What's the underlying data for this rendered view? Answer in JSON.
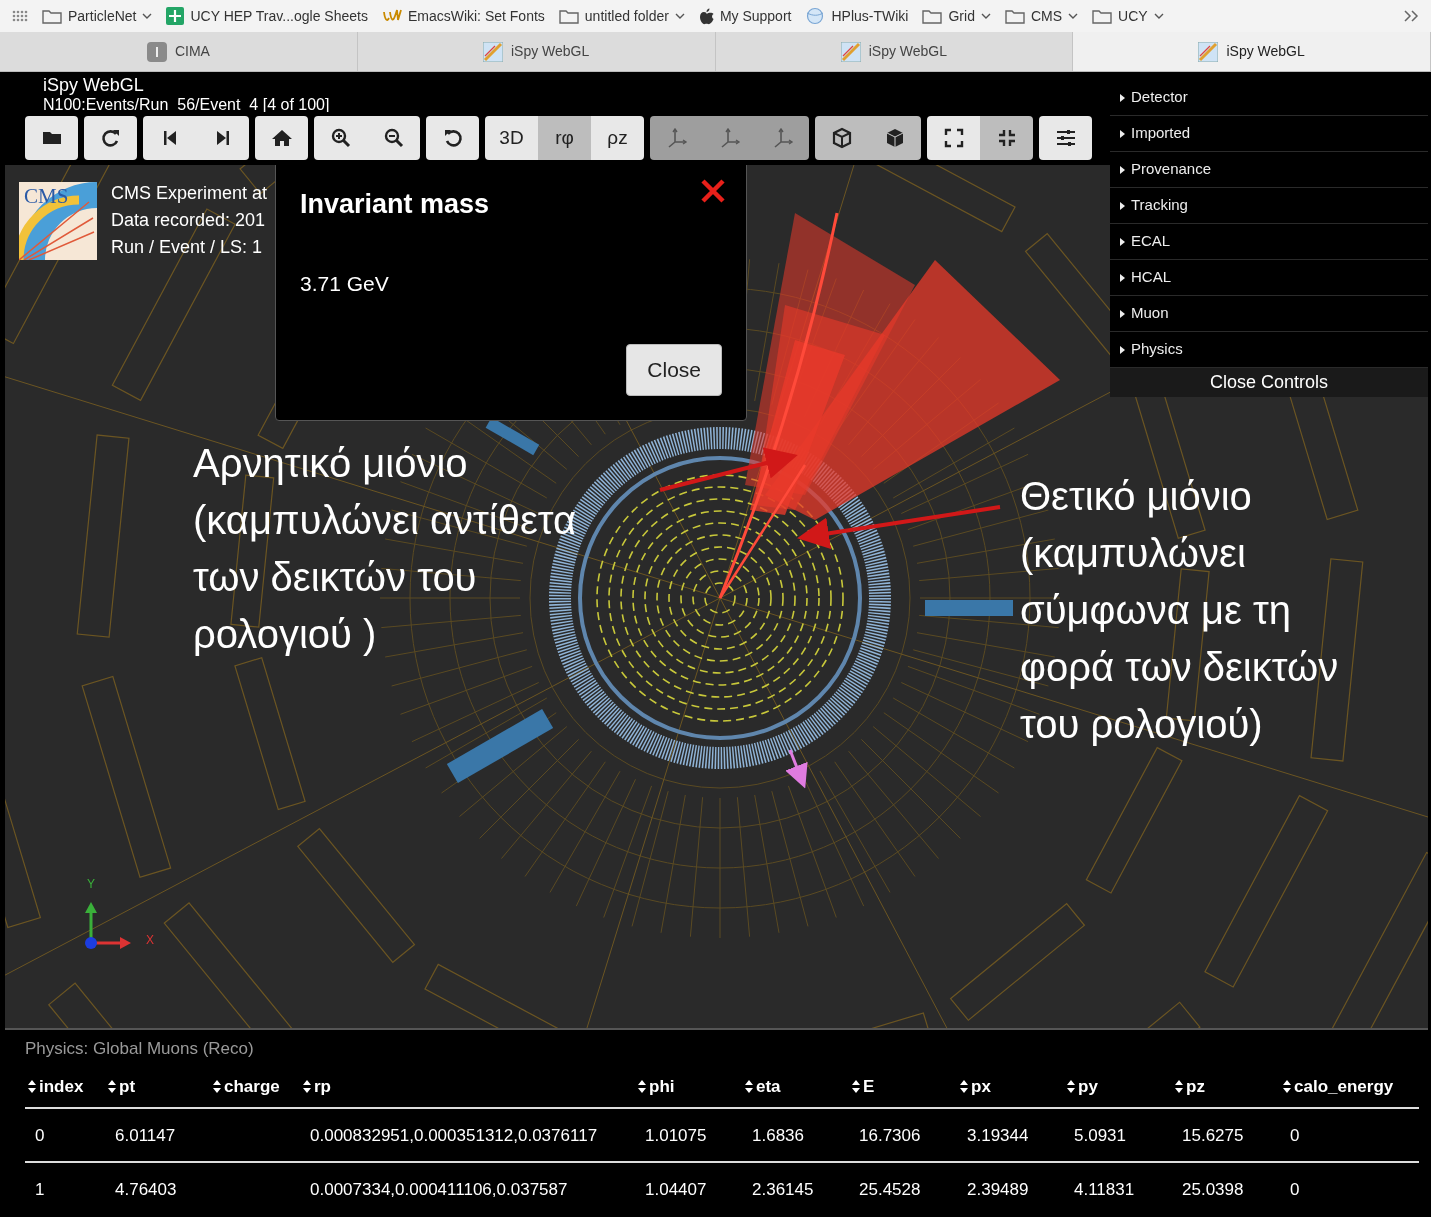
{
  "browser": {
    "bookmarks": [
      {
        "label": "ParticleNet",
        "kind": "folder",
        "has_menu": true
      },
      {
        "label": "UCY HEP Trav...ogle Sheets",
        "kind": "sheet",
        "has_menu": false
      },
      {
        "label": "EmacsWiki: Set Fonts",
        "kind": "wiki",
        "has_menu": false
      },
      {
        "label": "untitled folder",
        "kind": "folder",
        "has_menu": true
      },
      {
        "label": "My Support",
        "kind": "apple",
        "has_menu": false
      },
      {
        "label": "HPlus-TWiki",
        "kind": "globe",
        "has_menu": false
      },
      {
        "label": "Grid",
        "kind": "folder",
        "has_menu": true
      },
      {
        "label": "CMS",
        "kind": "folder",
        "has_menu": true
      },
      {
        "label": "UCY",
        "kind": "folder",
        "has_menu": true
      }
    ],
    "tabs": [
      {
        "label": "CIMA",
        "kind": "letter",
        "selected": false
      },
      {
        "label": "iSpy WebGL",
        "kind": "image",
        "selected": false
      },
      {
        "label": "iSpy WebGL",
        "kind": "image",
        "selected": false
      },
      {
        "label": "iSpy WebGL",
        "kind": "image",
        "selected": true
      }
    ]
  },
  "app": {
    "title": "iSpy WebGL",
    "event_path": "N100:Events/Run_56/Event_4 [4 of 100]"
  },
  "toolbar": [
    [
      {
        "kind": "folder",
        "selected": false,
        "disabled": false
      }
    ],
    [
      {
        "kind": "redo",
        "selected": false,
        "disabled": false
      }
    ],
    [
      {
        "kind": "previous",
        "selected": false,
        "disabled": false
      },
      {
        "kind": "next",
        "selected": false,
        "disabled": false
      }
    ],
    [
      {
        "kind": "home",
        "selected": false,
        "disabled": false
      }
    ],
    [
      {
        "kind": "zoom-in",
        "selected": false,
        "disabled": false
      },
      {
        "kind": "zoom-out",
        "selected": false,
        "disabled": false
      }
    ],
    [
      {
        "kind": "undo",
        "selected": false,
        "disabled": false
      }
    ],
    [
      {
        "kind": "text",
        "label": "3D",
        "selected": false,
        "disabled": false
      },
      {
        "kind": "text",
        "label": "rφ",
        "selected": true,
        "disabled": false
      },
      {
        "kind": "text",
        "label": "ρz",
        "selected": false,
        "disabled": false
      }
    ],
    [
      {
        "kind": "axes",
        "selected": false,
        "disabled": true
      },
      {
        "kind": "axes",
        "selected": false,
        "disabled": true
      },
      {
        "kind": "axes",
        "selected": false,
        "disabled": true
      }
    ],
    [
      {
        "kind": "cube",
        "selected": true,
        "disabled": false
      },
      {
        "kind": "cube-solid",
        "selected": true,
        "disabled": false
      }
    ],
    [
      {
        "kind": "expand",
        "selected": false,
        "disabled": false
      },
      {
        "kind": "compress",
        "selected": true,
        "disabled": false
      }
    ],
    [
      {
        "kind": "sliders",
        "selected": false,
        "disabled": false
      }
    ]
  ],
  "event_info": {
    "logo_text": "CMS",
    "lines": [
      "CMS Experiment at",
      "Data recorded: 201",
      "Run / Event / LS: 1"
    ]
  },
  "controls": {
    "items": [
      "Detector",
      "Imported",
      "Provenance",
      "Tracking",
      "ECAL",
      "HCAL",
      "Muon",
      "Physics"
    ],
    "close_label": "Close Controls"
  },
  "modal": {
    "title": "Invariant mass",
    "body": "3.71 GeV",
    "button": "Close"
  },
  "annotations": [
    {
      "text": "Αρνητικό μιόνιο (καμπυλώνει αντίθετα των δεικτών του ρολογιού )"
    },
    {
      "text": "Θετικό μιόνιο (καμπυλώνει σύμφωνα με τη φορά των δεικτών του ρολογιού)"
    }
  ],
  "axes": {
    "y": "Y",
    "x": "X"
  },
  "table": {
    "caption": "Physics: Global Muons (Reco)",
    "columns": [
      "index",
      "pt",
      "charge",
      "rp",
      "phi",
      "eta",
      "E",
      "px",
      "py",
      "pz",
      "calo_energy"
    ],
    "rows": [
      [
        "0",
        "6.01147",
        null,
        "0.000832951,0.000351312,0.0376117",
        "1.01075",
        "1.6836",
        "16.7306",
        "3.19344",
        "5.0931",
        "15.6275",
        "0"
      ],
      [
        "1",
        "4.76403",
        null,
        "0.0007334,0.000411106,0.037587",
        "1.04407",
        "2.36145",
        "25.4528",
        "2.39489",
        "4.11831",
        "25.0398",
        "0"
      ]
    ]
  }
}
